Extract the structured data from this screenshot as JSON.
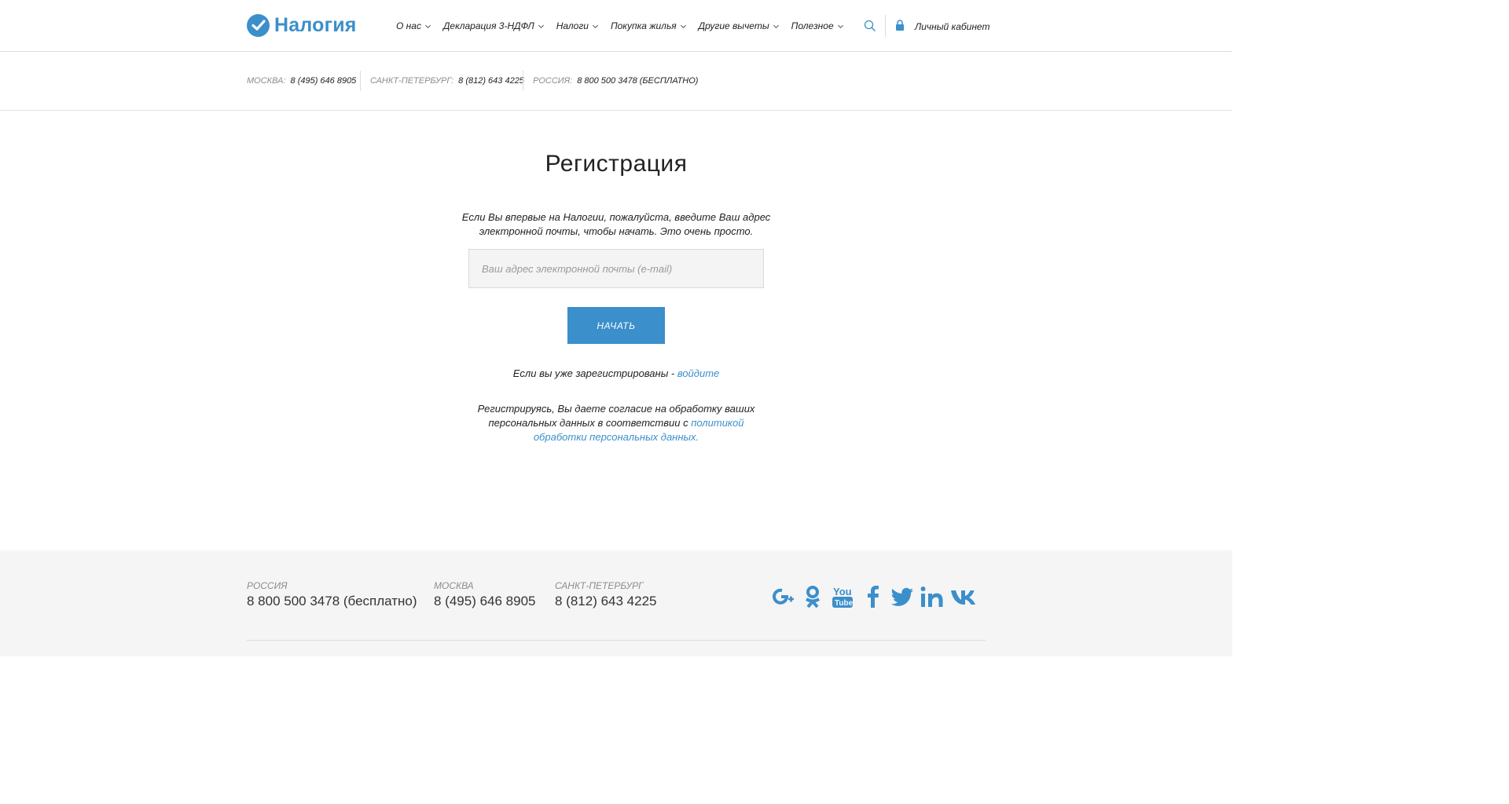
{
  "header": {
    "logo_text": "Налогия",
    "nav": [
      {
        "label": "О нас"
      },
      {
        "label": "Декларация 3-НДФЛ"
      },
      {
        "label": "Налоги"
      },
      {
        "label": "Покупка жилья"
      },
      {
        "label": "Другие вычеты"
      },
      {
        "label": "Полезное"
      }
    ],
    "cabinet_label": "Личный кабинет",
    "accent_color": "#3b8fcb"
  },
  "contacts": [
    {
      "label": "Москва:",
      "phone": "8 (495) 646 8905"
    },
    {
      "label": "Санкт-Петербург:",
      "phone": "8 (812) 643 4225"
    },
    {
      "label": "Россия:",
      "phone": "8 800 500 3478 (бесплатно)"
    }
  ],
  "main": {
    "title": "Регистрация",
    "intro": "Если Вы впервые на Налогии, пожалуйста, введите Ваш адрес электронной почты, чтобы начать. Это очень просто.",
    "email_placeholder": "Ваш адрес электронной почты (e-mail)",
    "email_value": "",
    "start_button": "Начать",
    "login_prefix": "Если вы уже зарегистрированы - ",
    "login_link": "войдите",
    "consent_text": "Регистрируясь, Вы даете согласие на обработку ваших персональных данных в соответствии с ",
    "consent_link": "политикой обработки персональных данных."
  },
  "footer": {
    "contacts": [
      {
        "label": "Россия",
        "phone": "8 800 500 3478 (бесплатно)"
      },
      {
        "label": "Москва",
        "phone": "8 (495) 646 8905"
      },
      {
        "label": "Санкт-Петербург",
        "phone": "8 (812) 643 4225"
      }
    ],
    "socials": [
      "google-plus-icon",
      "odnoklassniki-icon",
      "youtube-icon",
      "facebook-icon",
      "twitter-icon",
      "linkedin-icon",
      "vk-icon"
    ]
  }
}
